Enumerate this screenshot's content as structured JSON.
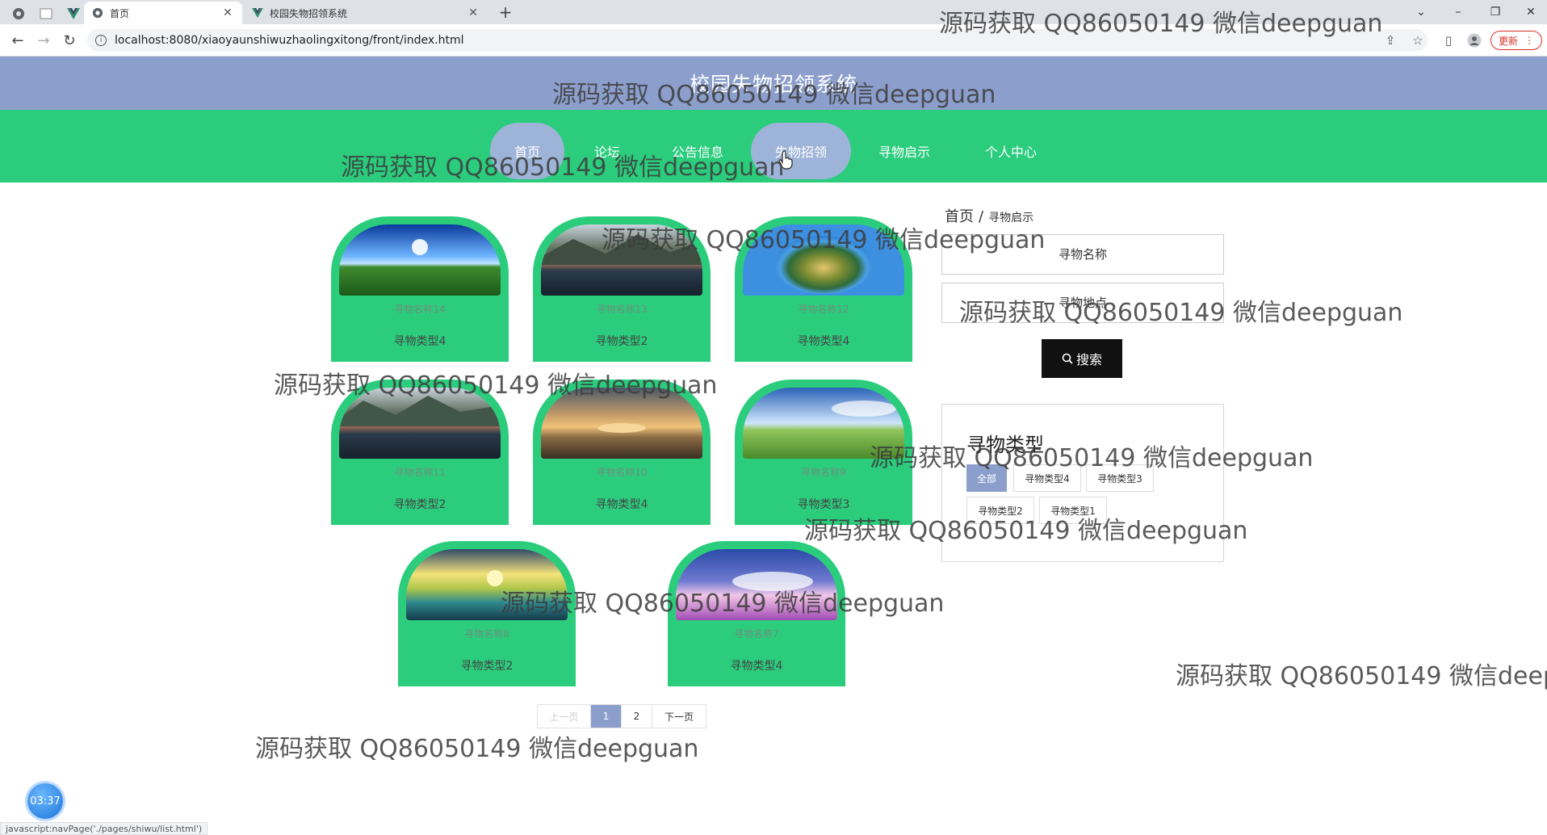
{
  "browser": {
    "tabs": [
      {
        "title": "首页",
        "active": true
      },
      {
        "title": "校园失物招领系统",
        "active": false
      }
    ],
    "url": "localhost:8080/xiaoyaunshiwuzhaolingxitong/front/index.html",
    "update_label": "更新",
    "status_url": "javascript:navPage('./pages/shiwu/list.html')"
  },
  "site": {
    "title": "校园失物招领系统",
    "nav": [
      "首页",
      "论坛",
      "公告信息",
      "失物招领",
      "寻物启示",
      "个人中心"
    ]
  },
  "items": [
    {
      "name": "寻物名称14",
      "type": "寻物类型4"
    },
    {
      "name": "寻物名称13",
      "type": "寻物类型2"
    },
    {
      "name": "寻物名称12",
      "type": "寻物类型4"
    },
    {
      "name": "寻物名称11",
      "type": "寻物类型2"
    },
    {
      "name": "寻物名称10",
      "type": "寻物类型4"
    },
    {
      "name": "寻物名称9",
      "type": "寻物类型3"
    },
    {
      "name": "寻物名称8",
      "type": "寻物类型2"
    },
    {
      "name": "寻物名称7",
      "type": "寻物类型4"
    }
  ],
  "pagination": {
    "prev": "上一页",
    "pages": [
      "1",
      "2"
    ],
    "current": "1",
    "next": "下一页"
  },
  "breadcrumb": {
    "home": "首页",
    "sep": "/",
    "current": "寻物启示"
  },
  "search": {
    "name_placeholder": "寻物名称",
    "place_placeholder": "寻物地点",
    "button_label": "搜索"
  },
  "type_filter": {
    "title": "寻物类型",
    "options": [
      "全部",
      "寻物类型4",
      "寻物类型3",
      "寻物类型2",
      "寻物类型1"
    ],
    "selected": "全部"
  },
  "watermark_text": "源码获取 QQ86050149 微信deepguan",
  "timer": "03:37",
  "colors": {
    "header": "#8c9fcc",
    "nav": "#2bcd7d",
    "accent": "#8c9fcc",
    "button": "#111111"
  }
}
